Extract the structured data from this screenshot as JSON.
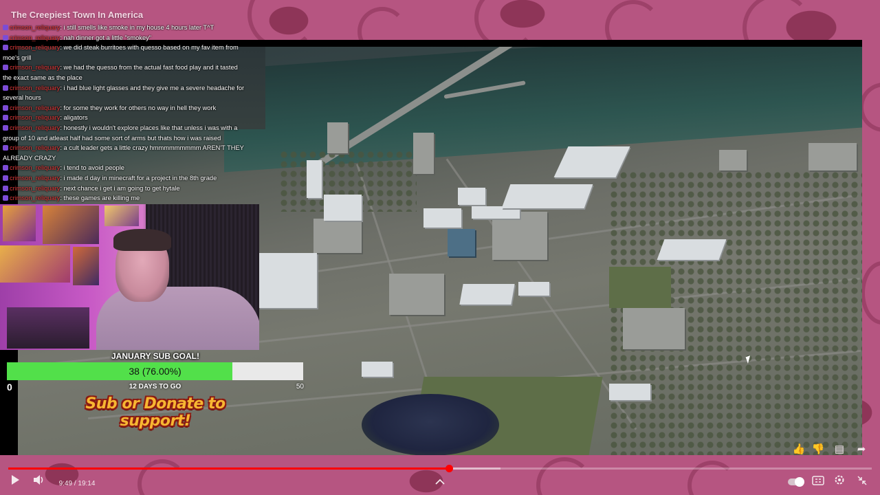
{
  "video": {
    "title": "The Creepiest Town In America"
  },
  "chat": [
    {
      "user": "crimson_reliquary",
      "message": "i still smells like smoke in my house 4 hours later T^T"
    },
    {
      "user": "crimson_reliquary",
      "message": "nah dinner got a little \"smokey\""
    },
    {
      "user": "crimson_reliquary",
      "message": "we did steak burritoes with quesso based on my fav item from moe's grill"
    },
    {
      "user": "crimson_reliquary",
      "message": "we had the quesso from the actual fast food play and it tasted the exact same as the place"
    },
    {
      "user": "crimson_reliquary",
      "message": "i had blue light glasses and they give me a severe headache for several hours"
    },
    {
      "user": "crimson_reliquary",
      "message": "for some they work for others no way in hell they work"
    },
    {
      "user": "crimson_reliquary",
      "message": "aligators"
    },
    {
      "user": "crimson_reliquary",
      "message": "honestly i wouldn't explore places like that unless i was with a group of 10 and atleast half had some sort of arms but thats how i was raised"
    },
    {
      "user": "crimson_reliquary",
      "message": "a cult leader gets a little crazy hmmmmmmmmm AREN'T THEY ALREADY CRAZY"
    },
    {
      "user": "crimson_reliquary",
      "message": "i tend to avoid people"
    },
    {
      "user": "crimson_reliquary",
      "message": "i made d day in minecraft for a project in the 8th grade"
    },
    {
      "user": "crimson_reliquary",
      "message": "next chance i get i am going to get hytale"
    },
    {
      "user": "crimson_reliquary",
      "message": "these games are killing me"
    }
  ],
  "sub_goal": {
    "title": "JANUARY SUB GOAL!",
    "current_text": "38 (76.00%)",
    "progress": 0.76,
    "min": "0",
    "max": "50",
    "days_left": "12 DAYS TO GO",
    "banner": "Sub or Donate to support!"
  },
  "actions": {
    "like_icon": "thumbs-up-icon",
    "dislike_icon": "thumbs-down-icon",
    "comment_icon": "comment-icon",
    "share_icon": "share-icon"
  },
  "player": {
    "time_current": "9:49",
    "time_total": "19:14",
    "time_text": "9:49 / 19:14",
    "progress": 0.51,
    "buffered": 0.57,
    "colors": {
      "played": "#ff0000"
    }
  }
}
